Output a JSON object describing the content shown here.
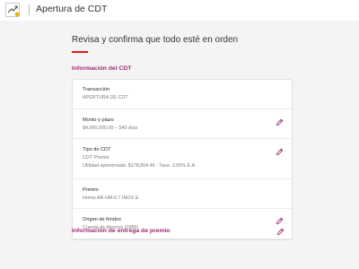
{
  "header": {
    "title": "Apertura de CDT",
    "logo_icon": "bank-logo-icon"
  },
  "main": {
    "heading": "Revisa y confirma que todo esté en orden",
    "accent_color": "#e3181c",
    "section_color": "#9c2a72",
    "cdt_section_title": "Información del CDT",
    "rows": [
      {
        "label": "Transacción",
        "values": [
          "APERTURA DE CDT"
        ],
        "editable": false
      },
      {
        "label": "Monto y plazo",
        "values": [
          "$4,000,000.00 – 540 días"
        ],
        "editable": true
      },
      {
        "label": "Tipo de CDT",
        "values": [
          "CDT Premio",
          "Utilidad aproximada:  $178,804.46 - Tasa: 3.00% E.A."
        ],
        "editable": true
      },
      {
        "label": "Premio",
        "values": [
          "Horno AR HM-0.7 INOX E"
        ],
        "editable": false
      },
      {
        "label": "Origen de fondos",
        "values": [
          "Cuenta de Ahorros (2989)"
        ],
        "editable": true
      }
    ],
    "delivery_section_title": "Información de entrega de premio",
    "edit_icon": "pencil-icon"
  }
}
